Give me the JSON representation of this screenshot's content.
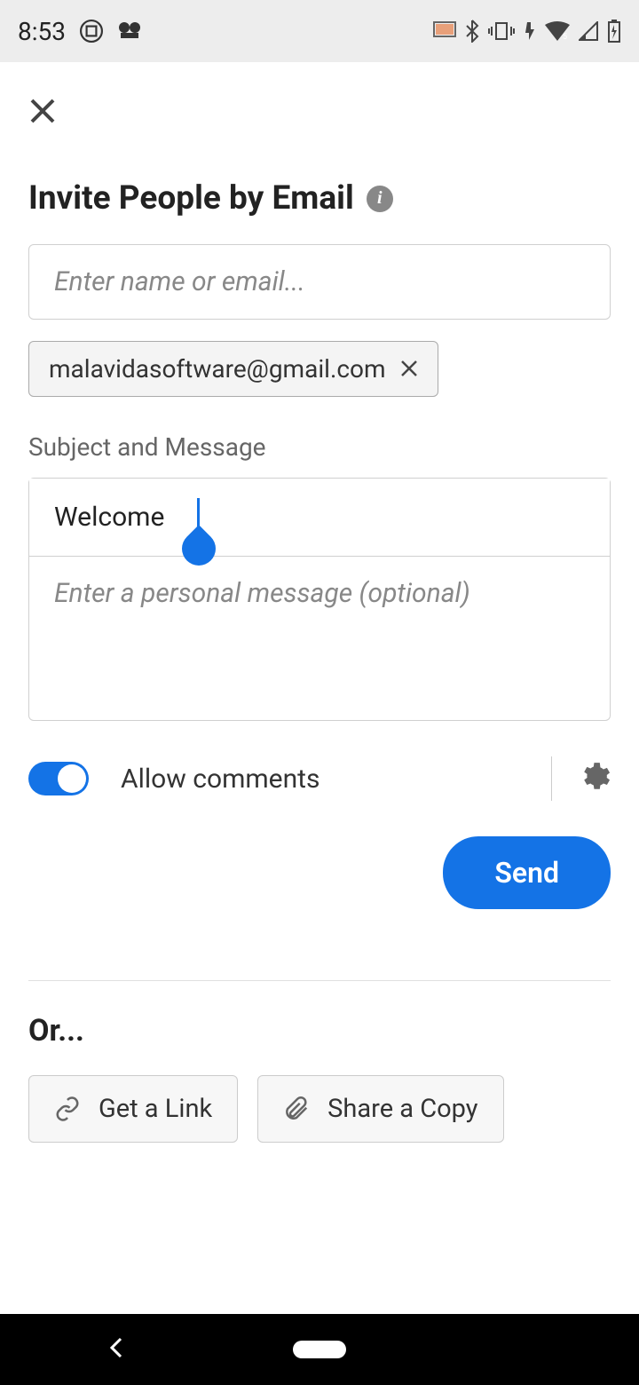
{
  "statusBar": {
    "time": "8:53"
  },
  "header": {
    "title": "Invite People by Email"
  },
  "form": {
    "emailPlaceholder": "Enter name or email...",
    "chipEmail": "malavidasoftware@gmail.com",
    "sectionLabel": "Subject and Message",
    "subjectValue": "Welcome",
    "messagePlaceholder": "Enter a personal message (optional)",
    "toggleLabel": "Allow comments",
    "sendLabel": "Send"
  },
  "alternatives": {
    "orLabel": "Or...",
    "getLinkLabel": "Get a Link",
    "shareCopyLabel": "Share a Copy"
  }
}
